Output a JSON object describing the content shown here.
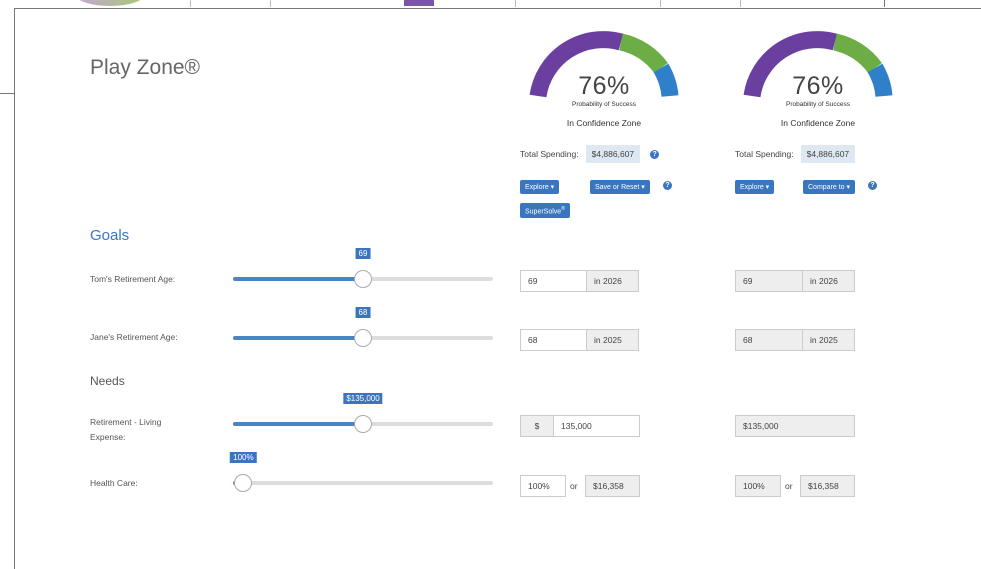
{
  "title": "Play Zone®",
  "colors": {
    "accent": "#3a75c0",
    "gauge_purple": "#6b3fa0",
    "gauge_green": "#6cae45",
    "gauge_blue": "#2f7fc9"
  },
  "scenarios": [
    {
      "percent": "76%",
      "probability_label": "Probability of Success",
      "zone_label": "In Confidence Zone",
      "total_spending_label": "Total Spending:",
      "total_spending_value": "$4,886,607",
      "buttons": [
        "Explore ▾",
        "Save or Reset ▾"
      ],
      "supersolve": "SuperSolve",
      "supersolve_mark": "®"
    },
    {
      "percent": "76%",
      "probability_label": "Probability of Success",
      "zone_label": "In Confidence Zone",
      "total_spending_label": "Total Spending:",
      "total_spending_value": "$4,886,607",
      "buttons": [
        "Explore ▾",
        "Compare to ▾"
      ]
    }
  ],
  "goals": {
    "heading": "Goals",
    "rows": [
      {
        "label": "Tom's Retirement Age:",
        "tooltip": "69",
        "value": "69",
        "year": "in 2026",
        "compare_value": "69",
        "compare_year": "in 2026"
      },
      {
        "label": "Jane's Retirement Age:",
        "tooltip": "68",
        "value": "68",
        "year": "in 2025",
        "compare_value": "68",
        "compare_year": "in 2025"
      }
    ]
  },
  "needs": {
    "heading": "Needs",
    "rows": [
      {
        "label_line1": "Retirement - Living",
        "label_line2": "Expense:",
        "tooltip": "$135,000",
        "currency": "$",
        "value": "135,000",
        "compare_value": "$135,000"
      },
      {
        "label": "Health Care:",
        "tooltip": "100%",
        "percent": "100%",
        "or": "or",
        "amount": "$16,358",
        "compare_percent": "100%",
        "compare_or": "or",
        "compare_amount": "$16,358"
      }
    ]
  },
  "slider_levels": {
    "toms_age": 0.5,
    "janes_age": 0.5,
    "living_expense": 0.5,
    "health_care": 0.04
  }
}
